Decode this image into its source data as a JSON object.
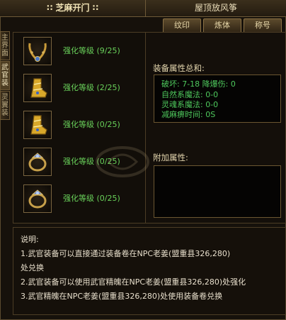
{
  "header": {
    "title": "∷ 芝麻开门 ∷",
    "right_title": "屋顶放风筝"
  },
  "tabs": [
    {
      "label": "纹印"
    },
    {
      "label": "炼体"
    },
    {
      "label": "称号"
    }
  ],
  "side_nav": [
    {
      "label": "主界面"
    },
    {
      "label": "武官装"
    },
    {
      "label": "灵翼装"
    }
  ],
  "items": [
    {
      "label": "强化等级 (9/25)",
      "icon": "necklace-icon"
    },
    {
      "label": "强化等级 (2/25)",
      "icon": "boot-icon"
    },
    {
      "label": "强化等级 (0/25)",
      "icon": "boot-icon"
    },
    {
      "label": "强化等级 (0/25)",
      "icon": "ring-icon"
    },
    {
      "label": "强化等级 (0/25)",
      "icon": "ring-icon"
    }
  ],
  "stats": {
    "title": "装备属性总和:",
    "rows": [
      {
        "text": "破坏: 7-18    降爆伤: 0"
      },
      {
        "text": "自然系魔法: 0-0"
      },
      {
        "text": "灵魂系魔法: 0-0"
      },
      {
        "text": "减麻痹时间: 0S"
      }
    ]
  },
  "extra": {
    "title": "附加属性:"
  },
  "info": {
    "lines": [
      "说明:",
      "1.武官装备可以直接通过装备卷在NPC老姜(盟重县326,280)",
      "处兑换",
      "2.武官装备可以使用武官精魄在NPC老姜(盟重县326,280)处强化",
      "3.武官精魄在NPC老姜(盟重县326,280)处使用装备卷兑换"
    ]
  }
}
